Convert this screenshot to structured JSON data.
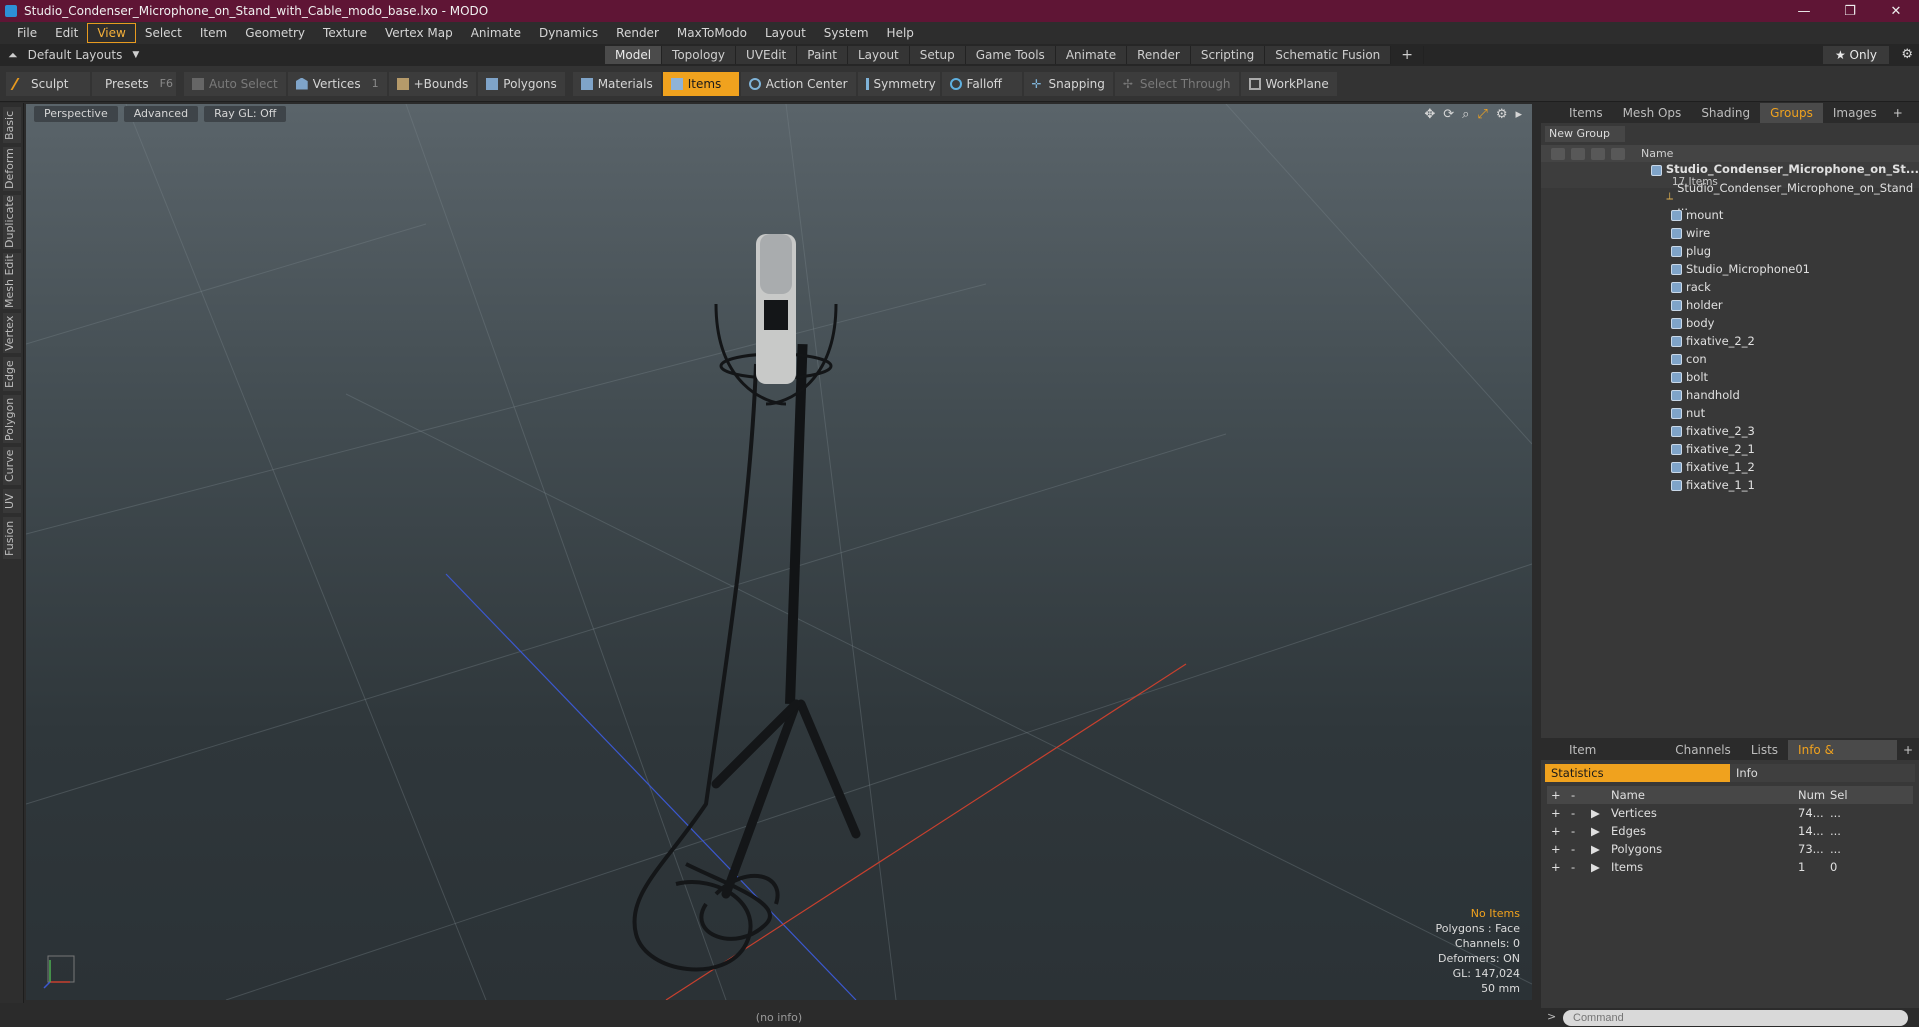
{
  "window": {
    "title": "Studio_Condenser_Microphone_on_Stand_with_Cable_modo_base.lxo - MODO",
    "minimize": "—",
    "maximize": "❐",
    "close": "✕"
  },
  "menu": [
    "File",
    "Edit",
    "View",
    "Select",
    "Item",
    "Geometry",
    "Texture",
    "Vertex Map",
    "Animate",
    "Dynamics",
    "Render",
    "MaxToModo",
    "Layout",
    "System",
    "Help"
  ],
  "menu_active": "View",
  "layouts": {
    "label": "Default Layouts"
  },
  "layout_tabs": [
    "Model",
    "Topology",
    "UVEdit",
    "Paint",
    "Layout",
    "Setup",
    "Game Tools",
    "Animate",
    "Render",
    "Scripting",
    "Schematic Fusion"
  ],
  "layout_tab_active": "Model",
  "only_label": "★  Only",
  "toolbar": {
    "sculpt": "Sculpt",
    "presets": "Presets",
    "presets_key": "F6",
    "auto_select": "Auto Select",
    "vertices": "Vertices",
    "vertices_num": "1",
    "bounds": "+Bounds",
    "polygons": "Polygons",
    "materials": "Materials",
    "items": "Items",
    "action_center": "Action Center",
    "symmetry": "Symmetry",
    "falloff": "Falloff",
    "snapping": "Snapping",
    "select_through": "Select Through",
    "workplane": "WorkPlane"
  },
  "left_tabs": [
    "Basic",
    "Deform",
    "Duplicate",
    "Mesh Edit",
    "Vertex",
    "Edge",
    "Polygon",
    "Curve",
    "UV",
    "Fusion"
  ],
  "viewport": {
    "perspective": "Perspective",
    "advanced": "Advanced",
    "raygl": "Ray GL: Off",
    "info": {
      "no_items": "No Items",
      "polygons": "Polygons : Face",
      "channels": "Channels: 0",
      "deformers": "Deformers: ON",
      "gl": "GL: 147,024",
      "scale": "50 mm"
    }
  },
  "status": "(no info)",
  "items_panel": {
    "tabs": [
      "Items",
      "Mesh Ops",
      "Shading",
      "Groups",
      "Images"
    ],
    "active_tab": "Groups",
    "new_group": "New Group",
    "col_name": "Name",
    "group_name": "Studio_Condenser_Microphone_on_St...",
    "group_count": "17 Items",
    "items": [
      "Studio_Condenser_Microphone_on_Stand ...",
      "mount",
      "wire",
      "plug",
      "Studio_Microphone01",
      "rack",
      "holder",
      "body",
      "fixative_2_2",
      "con",
      "bolt",
      "handhold",
      "nut",
      "fixative_2_3",
      "fixative_2_1",
      "fixative_1_2",
      "fixative_1_1"
    ]
  },
  "props_panel": {
    "tabs": [
      "Item Properties",
      "Channels",
      "Lists",
      "Info & Statistics"
    ],
    "active_tab": "Info & Statistics",
    "stat_tabs": [
      "Statistics",
      "Info"
    ],
    "columns": [
      "Name",
      "Num",
      "Sel"
    ],
    "rows": [
      {
        "name": "Vertices",
        "num": "74...",
        "sel": "..."
      },
      {
        "name": "Edges",
        "num": "14...",
        "sel": "..."
      },
      {
        "name": "Polygons",
        "num": "73...",
        "sel": "..."
      },
      {
        "name": "Items",
        "num": "1",
        "sel": "0"
      }
    ]
  },
  "command": {
    "placeholder": "Command"
  },
  "colors": {
    "titlebar": "#5f1535",
    "accent": "#f0a21e"
  }
}
